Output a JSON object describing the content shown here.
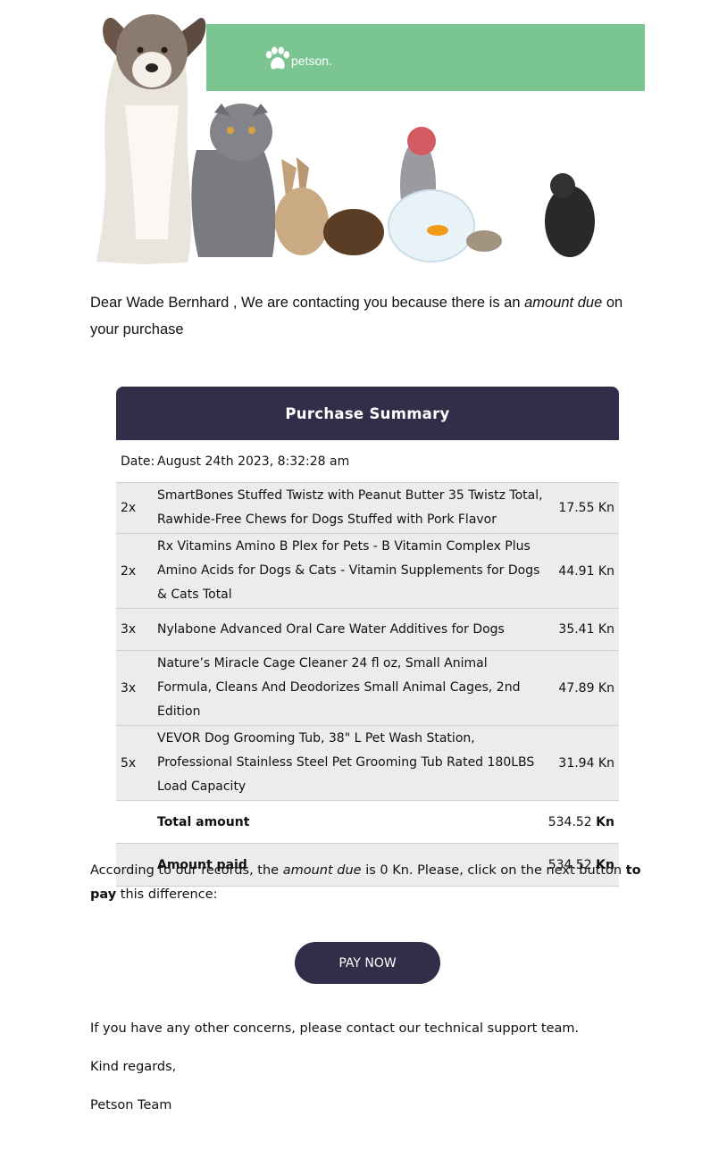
{
  "brand": {
    "name": "petson.",
    "color": "#7bc592",
    "icon": "paw-icon"
  },
  "greeting": {
    "prefix": "Dear Wade Bernhard , We are contacting you because there is an ",
    "emphasis": "amount due",
    "suffix": " on your purchase"
  },
  "summary": {
    "title": "Purchase Summary",
    "date_label": "Date:",
    "date_value": "August 24th 2023, 8:32:28 am",
    "items": [
      {
        "qty": "2x",
        "name": "SmartBones Stuffed Twistz with Peanut Butter 35 Twistz Total, Rawhide-Free Chews for Dogs Stuffed with Pork Flavor",
        "price": "17.55 Kn"
      },
      {
        "qty": "2x",
        "name": "Rx Vitamins Amino B Plex for Pets - B Vitamin Complex Plus Amino Acids for Dogs & Cats - Vitamin Supplements for Dogs & Cats Total",
        "price": "44.91 Kn"
      },
      {
        "qty": "3x",
        "name": "Nylabone Advanced Oral Care Water Additives for Dogs",
        "price": "35.41 Kn"
      },
      {
        "qty": "3x",
        "name": "Nature’s Miracle Cage Cleaner 24 fl oz, Small Animal Formula, Cleans And Deodorizes Small Animal Cages, 2nd Edition",
        "price": "47.89 Kn"
      },
      {
        "qty": "5x",
        "name": "VEVOR Dog Grooming Tub, 38\" L Pet Wash Station, Professional Stainless Steel Pet Grooming Tub Rated 180LBS Load Capacity",
        "price": "31.94 Kn"
      }
    ],
    "total_label": "Total amount",
    "total_value": "534.52",
    "total_currency": "Kn",
    "paid_label": "Amount paid",
    "paid_value": "534.52",
    "paid_currency": "Kn"
  },
  "records": {
    "p1": "According to our records, the ",
    "emphasis": "amount due",
    "p2": " is 0 Kn. Please, click on the next button ",
    "bold": "to pay",
    "p3": " this difference:"
  },
  "pay_button": "PAY NOW",
  "closing": {
    "support": "If you have any other concerns, please contact our technical support team.",
    "regards": "Kind regards,",
    "team": "Petson Team"
  },
  "colors": {
    "accent": "#332d4a",
    "row_bg": "#ececec"
  }
}
